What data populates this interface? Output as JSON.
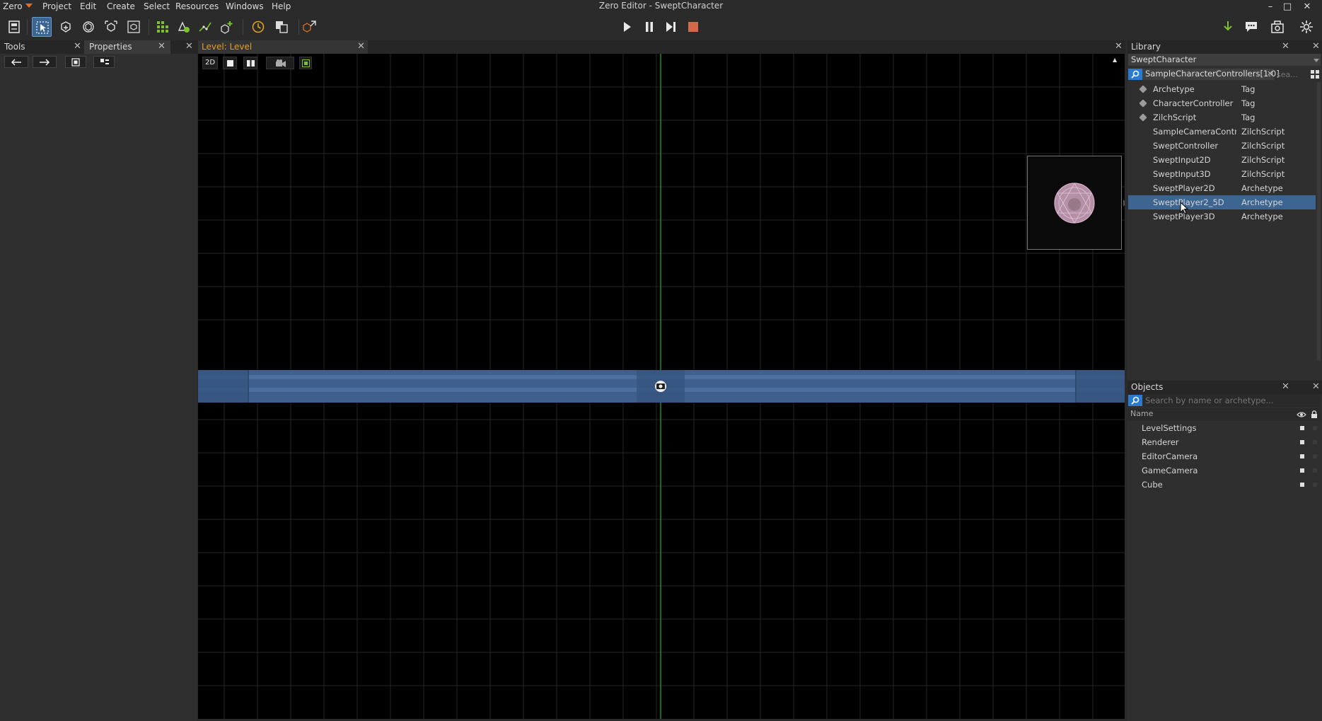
{
  "app": {
    "logo": "Zero",
    "title": "Zero Editor - SweptCharacter"
  },
  "menu": [
    "Project",
    "Edit",
    "Create",
    "Select",
    "Resources",
    "Windows",
    "Help"
  ],
  "window_controls": {
    "minimize": "–",
    "maximize": "□",
    "close": "✕"
  },
  "toolbar": {
    "icons": [
      "save-icon",
      "select-tool-icon",
      "translate-tool-icon",
      "rotate-tool-icon",
      "scale-tool-icon",
      "manipulator-tool-icon",
      "grid-icon",
      "add-resource-icon",
      "path-icon",
      "create-object-icon",
      "clock-icon",
      "copy-icon",
      "export-icon"
    ],
    "play_controls": [
      "play-icon",
      "pause-icon",
      "step-icon",
      "stop-icon"
    ],
    "right_icons": [
      "download-icon",
      "chat-icon",
      "package-icon",
      "settings-icon"
    ]
  },
  "left_panel": {
    "tabs": [
      "Tools",
      "Properties"
    ],
    "close": "✕"
  },
  "level_tab": {
    "label": "Level: Level",
    "close": "✕"
  },
  "viewport": {
    "mode_2d": "2D",
    "collapse": "▲"
  },
  "library": {
    "title": "Library",
    "close": "✕",
    "project": "SweptCharacter",
    "filter_tag": "SampleCharacterControllers[1.0]",
    "filter_close": "×",
    "search_placeholder": "sea...",
    "items": [
      {
        "name": "Archetype",
        "type": "Tag",
        "tag": true
      },
      {
        "name": "CharacterController",
        "type": "Tag",
        "tag": true
      },
      {
        "name": "ZilchScript",
        "type": "Tag",
        "tag": true
      },
      {
        "name": "SampleCameraControl",
        "type": "ZilchScript",
        "tag": false
      },
      {
        "name": "SweptController",
        "type": "ZilchScript",
        "tag": false
      },
      {
        "name": "SweptInput2D",
        "type": "ZilchScript",
        "tag": false
      },
      {
        "name": "SweptInput3D",
        "type": "ZilchScript",
        "tag": false
      },
      {
        "name": "SweptPlayer2D",
        "type": "Archetype",
        "tag": false
      },
      {
        "name": "SweptPlayer2_5D",
        "type": "Archetype",
        "tag": false,
        "selected": true
      },
      {
        "name": "SweptPlayer3D",
        "type": "Archetype",
        "tag": false
      }
    ]
  },
  "objects": {
    "title": "Objects",
    "close": "✕",
    "search_placeholder": "Search by name or archetype...",
    "column_name": "Name",
    "items": [
      "LevelSettings",
      "Renderer",
      "EditorCamera",
      "GameCamera",
      "Cube"
    ]
  },
  "colors": {
    "accent": "#3d6591",
    "level_tab_text": "#e0a020",
    "grid_line": "#2a2a2a",
    "axis_line": "#1f8a1f",
    "floor": "#3f5f8c"
  }
}
